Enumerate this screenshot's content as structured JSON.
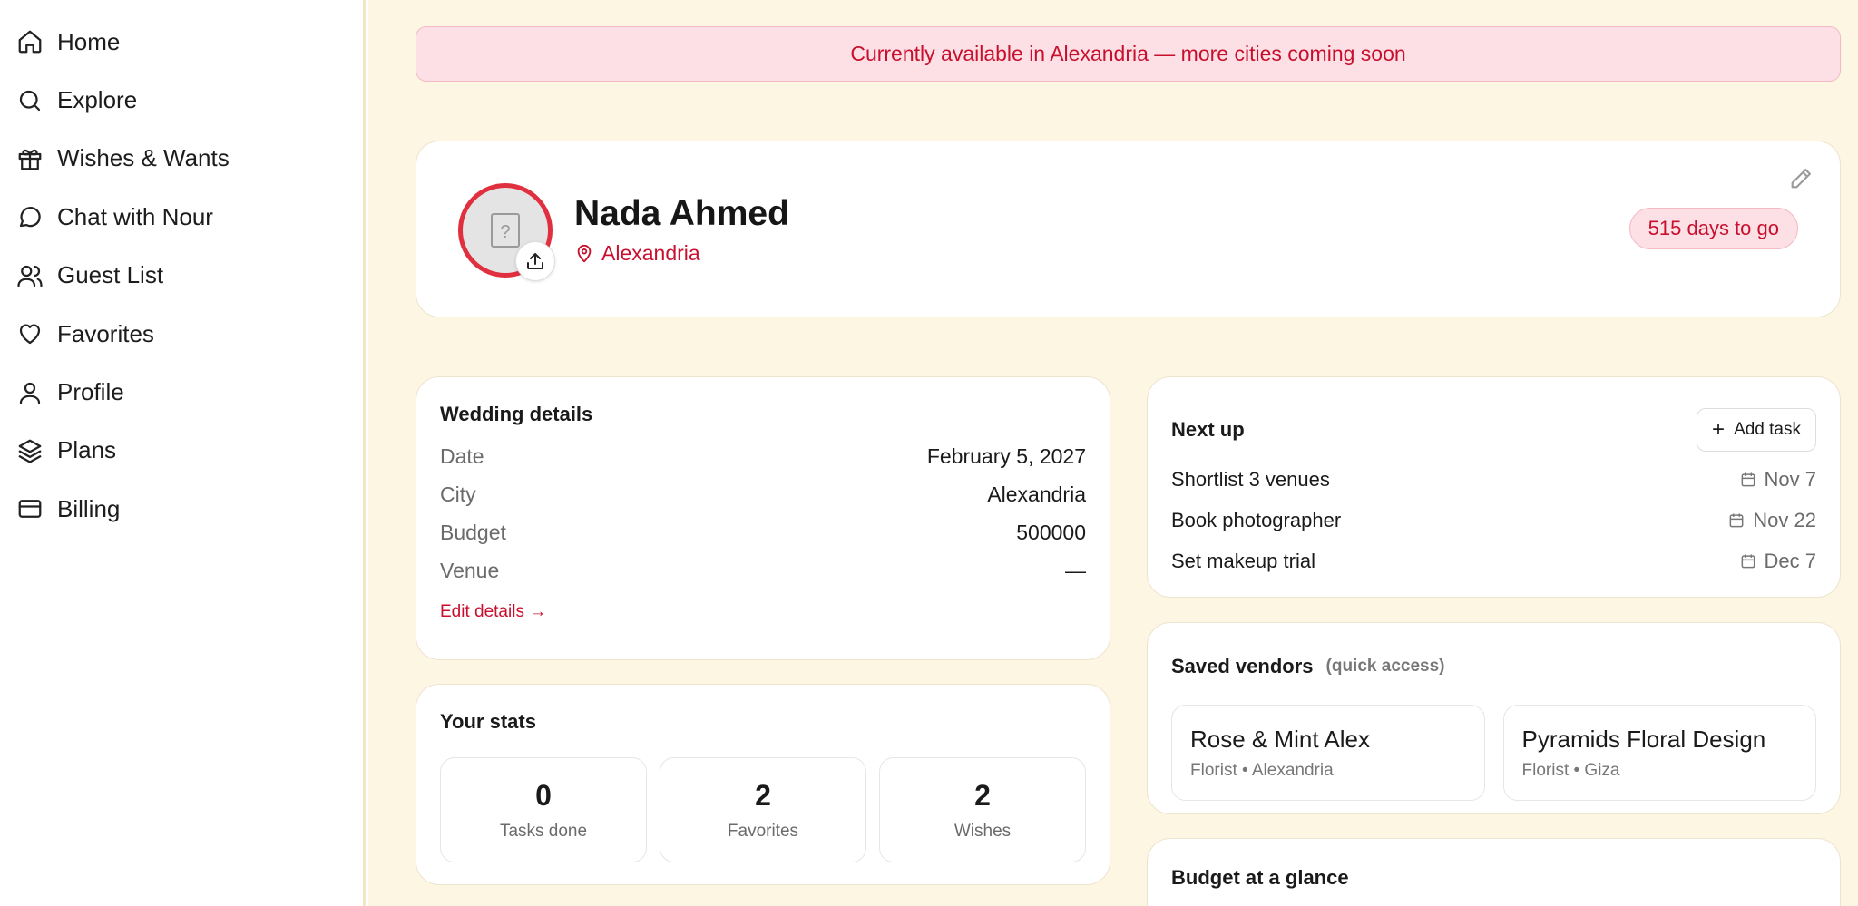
{
  "sidebar": {
    "items": [
      {
        "label": "Home",
        "icon": "home-icon"
      },
      {
        "label": "Explore",
        "icon": "search-icon"
      },
      {
        "label": "Wishes & Wants",
        "icon": "gift-icon"
      },
      {
        "label": "Chat with Nour",
        "icon": "chat-bubble-icon"
      },
      {
        "label": "Guest List",
        "icon": "users-icon"
      },
      {
        "label": "Favorites",
        "icon": "heart-icon"
      },
      {
        "label": "Profile",
        "icon": "user-icon"
      },
      {
        "label": "Plans",
        "icon": "layers-icon"
      },
      {
        "label": "Billing",
        "icon": "credit-card-icon"
      }
    ]
  },
  "banner": {
    "text": "Currently available in Alexandria — more cities coming soon"
  },
  "profile": {
    "name": "Nada Ahmed",
    "city": "Alexandria",
    "countdown": "515 days to go"
  },
  "wedding": {
    "title": "Wedding details",
    "rows": [
      {
        "key": "Date",
        "value": "February 5, 2027"
      },
      {
        "key": "City",
        "value": "Alexandria"
      },
      {
        "key": "Budget",
        "value": "500000"
      },
      {
        "key": "Venue",
        "value": "—"
      }
    ],
    "edit_link": "Edit details →"
  },
  "stats": {
    "title": "Your stats",
    "items": [
      {
        "value": "0",
        "label": "Tasks done"
      },
      {
        "value": "2",
        "label": "Favorites"
      },
      {
        "value": "2",
        "label": "Wishes"
      }
    ]
  },
  "nextup": {
    "title": "Next up",
    "add_label": "Add task",
    "tasks": [
      {
        "name": "Shortlist 3 venues",
        "due": "Nov 7"
      },
      {
        "name": "Book photographer",
        "due": "Nov 22"
      },
      {
        "name": "Set makeup trial",
        "due": "Dec 7"
      }
    ]
  },
  "vendors": {
    "title": "Saved vendors",
    "subtitle": "(quick access)",
    "items": [
      {
        "name": "Rose & Mint Alex",
        "meta": "Florist • Alexandria"
      },
      {
        "name": "Pyramids Floral Design",
        "meta": "Florist • Giza"
      }
    ]
  },
  "budget": {
    "title": "Budget at a glance"
  },
  "colors": {
    "accent": "#c8102e",
    "banner_bg": "#fde0e5",
    "page_bg": "#fdf6e3"
  }
}
